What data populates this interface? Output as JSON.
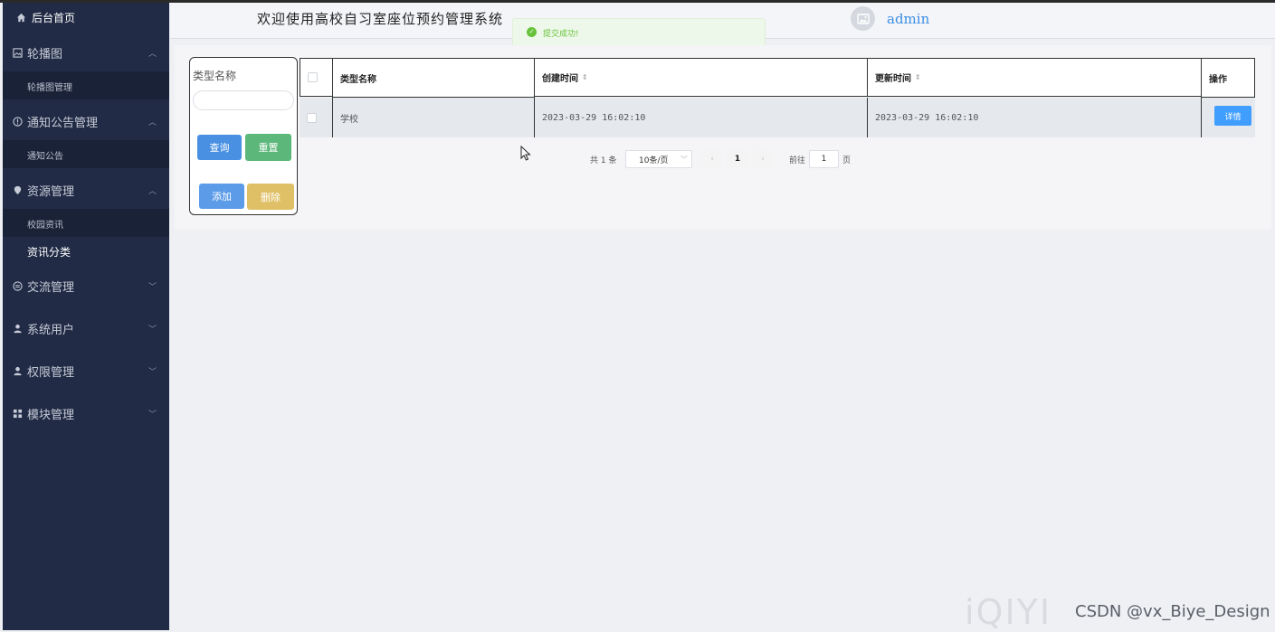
{
  "sidebar": {
    "home": "后台首页",
    "groups": [
      {
        "label": "轮播图",
        "icon": "image-icon",
        "expanded": true,
        "children": [
          "轮播图管理"
        ]
      },
      {
        "label": "通知公告管理",
        "icon": "info-circle-icon",
        "expanded": true,
        "children": [
          "通知公告"
        ]
      },
      {
        "label": "资源管理",
        "icon": "location-pin-icon",
        "expanded": true,
        "children": [
          "校园资讯",
          "资讯分类"
        ]
      },
      {
        "label": "交流管理",
        "icon": "chat-icon",
        "expanded": false
      },
      {
        "label": "系统用户",
        "icon": "user-icon",
        "expanded": false
      },
      {
        "label": "权限管理",
        "icon": "user-icon",
        "expanded": false
      },
      {
        "label": "模块管理",
        "icon": "grid-icon",
        "expanded": false
      }
    ]
  },
  "header": {
    "title": "欢迎使用高校自习室座位预约管理系统",
    "username": "admin"
  },
  "toast": {
    "message": "提交成功!"
  },
  "search": {
    "label": "类型名称",
    "input_value": "",
    "buttons": {
      "query": "查询",
      "reset": "重置",
      "add": "添加",
      "delete": "删除"
    }
  },
  "table": {
    "columns": [
      "类型名称",
      "创建时间",
      "更新时间",
      "操作"
    ],
    "rows": [
      {
        "name": "学校",
        "created": "2023-03-29 16:02:10",
        "updated": "2023-03-29 16:02:10",
        "action": "详情"
      }
    ]
  },
  "pagination": {
    "total_text": "共 1 条",
    "page_size": "10条/页",
    "current_page": "1",
    "goto_label": "前往",
    "goto_value": "1",
    "page_unit": "页"
  },
  "watermark": {
    "iqiyi": "iQIYI",
    "csdn": "CSDN @vx_Biye_Design"
  },
  "colors": {
    "sidebar_bg": "#212b45",
    "primary": "#409eff",
    "query_button": "#4a90e2",
    "reset_button": "#5cb87a",
    "add_button": "#5b9be8",
    "delete_button": "#e0c067",
    "success": "#67c23a"
  }
}
